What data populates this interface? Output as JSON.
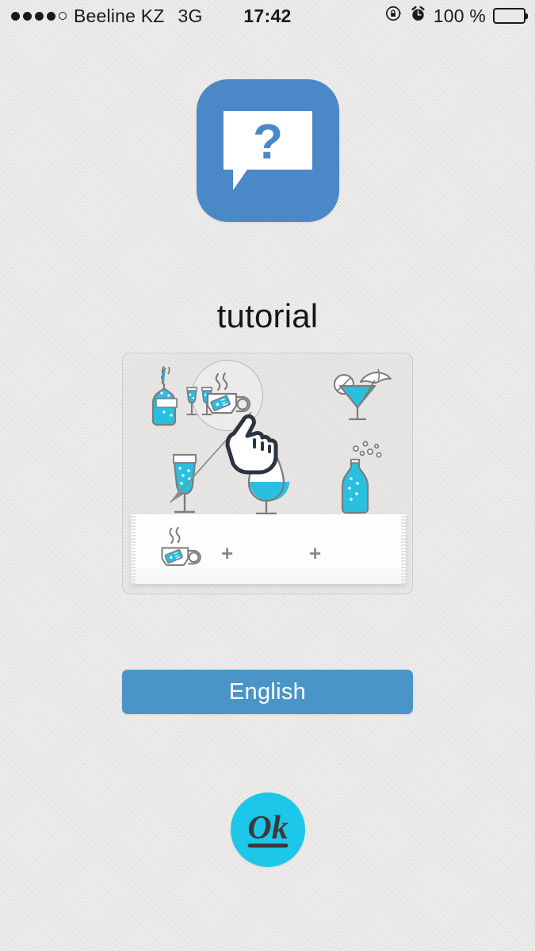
{
  "statusbar": {
    "signal": {
      "icon": "signal-dots-icon",
      "filled": 4,
      "total": 5
    },
    "carrier": "Beeline KZ",
    "network": "3G",
    "time": "17:42",
    "rotation_lock_icon": "rotation-lock-icon",
    "alarm_icon": "alarm-clock-icon",
    "battery_percent": "100 %",
    "battery_icon": "battery-full-icon"
  },
  "app": {
    "icon_name": "question-speech-bubble-icon",
    "icon_bg_color": "#4a88c8",
    "icon_glyph": "?"
  },
  "page": {
    "title": "tutorial"
  },
  "tutorial": {
    "card_name": "tutorial-illustration-card",
    "accent_color": "#29c0e0",
    "outline_color": "#7c7c7c",
    "grid_icons": [
      {
        "name": "champagne-bottle-and-flutes-icon",
        "label": "champagne bottle with two flutes"
      },
      {
        "name": "tea-cup-icon",
        "label": "tea cup with tea bag"
      },
      {
        "name": "cocktail-umbrella-icon",
        "label": "martini cocktail with umbrella"
      },
      {
        "name": "champagne-flute-icon",
        "label": "champagne flute"
      },
      {
        "name": "brandy-snifter-icon",
        "label": "brandy snifter"
      },
      {
        "name": "soda-bottle-icon",
        "label": "sparkling bottle with bubbles"
      }
    ],
    "highlight_ring_name": "selection-highlight-ring",
    "hand_cursor_name": "pointing-hand-cursor-icon",
    "drag_arrow_name": "drag-arrow-icon",
    "tray": {
      "name": "favorites-tray",
      "selected_icon": "tea-cup-icon",
      "empty_slot_1": "+",
      "empty_slot_2": "+"
    }
  },
  "language_button": {
    "label": "English",
    "color": "#4a95c8"
  },
  "branding": {
    "logo_name": "ok-logo",
    "logo_text": "Ok",
    "logo_color": "#1dc7ea"
  }
}
